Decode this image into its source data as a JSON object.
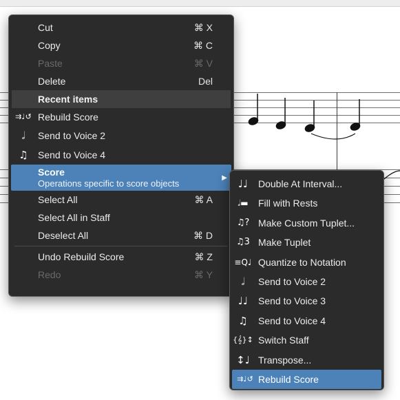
{
  "main_menu": {
    "cut": {
      "label": "Cut",
      "shortcut": "⌘ X"
    },
    "copy": {
      "label": "Copy",
      "shortcut": "⌘ C"
    },
    "paste": {
      "label": "Paste",
      "shortcut": "⌘ V"
    },
    "delete": {
      "label": "Delete",
      "shortcut": "Del"
    },
    "recent_header": "Recent items",
    "recent": [
      {
        "label": "Rebuild Score",
        "icon": "rebuild-score-icon",
        "glyph": "⇉♩↺"
      },
      {
        "label": "Send to Voice 2",
        "icon": "voice-2-icon",
        "glyph": "𝅗𝅥"
      },
      {
        "label": "Send to Voice 4",
        "icon": "voice-4-icon",
        "glyph": "♫"
      }
    ],
    "score": {
      "title": "Score",
      "description": "Operations specific to score objects",
      "arrow": "▶"
    },
    "select_all": {
      "label": "Select All",
      "shortcut": "⌘ A"
    },
    "select_all_staff": {
      "label": "Select All in Staff"
    },
    "deselect_all": {
      "label": "Deselect All",
      "shortcut": "⌘ D"
    },
    "undo": {
      "label": "Undo Rebuild Score",
      "shortcut": "⌘ Z"
    },
    "redo": {
      "label": "Redo",
      "shortcut": "⌘ Y"
    }
  },
  "submenu": [
    {
      "label": "Double At Interval...",
      "icon": "double-at-interval-icon",
      "glyph": "♩♩"
    },
    {
      "label": "Fill with Rests",
      "icon": "fill-with-rests-icon",
      "glyph": "𝅗𝅥▬"
    },
    {
      "label": "Make Custom Tuplet...",
      "icon": "custom-tuplet-icon",
      "glyph": "♫?"
    },
    {
      "label": "Make Tuplet",
      "icon": "tuplet-icon",
      "glyph": "♫3"
    },
    {
      "label": "Quantize to Notation",
      "icon": "quantize-icon",
      "glyph": "≡Q♩"
    },
    {
      "label": "Send to Voice 2",
      "icon": "voice-2-icon",
      "glyph": "𝅗𝅥"
    },
    {
      "label": "Send to Voice 3",
      "icon": "voice-3-icon",
      "glyph": "♩♩"
    },
    {
      "label": "Send to Voice 4",
      "icon": "voice-4-icon",
      "glyph": "♫"
    },
    {
      "label": "Switch Staff",
      "icon": "switch-staff-icon",
      "glyph": "{𝄞}↕"
    },
    {
      "label": "Transpose...",
      "icon": "transpose-icon",
      "glyph": "↕♩"
    },
    {
      "label": "Rebuild Score",
      "icon": "rebuild-score-icon",
      "glyph": "⇉♩↺"
    }
  ],
  "colors": {
    "menu_bg": "#2b2b2b",
    "highlight": "#4c82b8",
    "disabled": "#6a6a6a"
  }
}
